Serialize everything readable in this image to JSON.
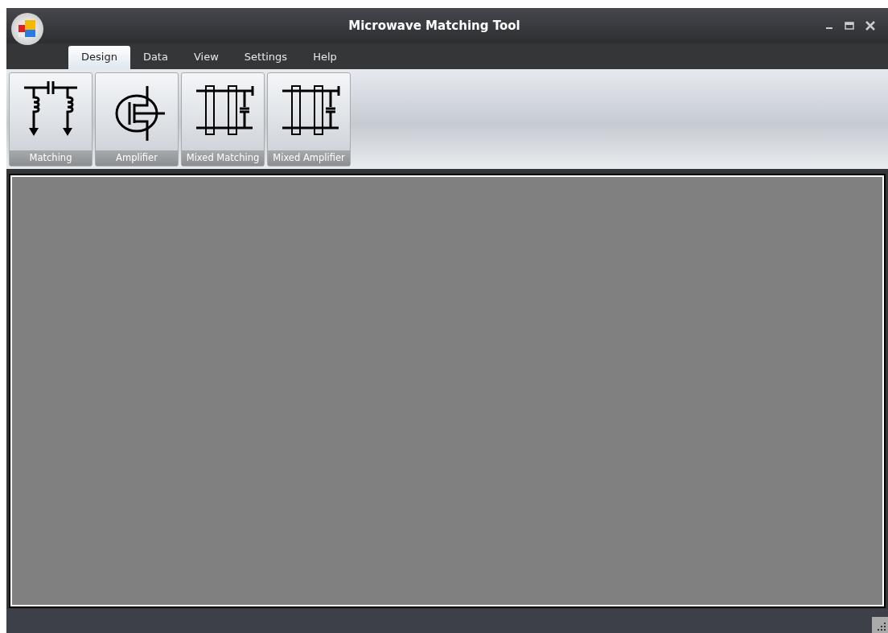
{
  "window": {
    "title": "Microwave Matching Tool"
  },
  "tabs": [
    {
      "label": "Design",
      "selected": true
    },
    {
      "label": "Data",
      "selected": false
    },
    {
      "label": "View",
      "selected": false
    },
    {
      "label": "Settings",
      "selected": false
    },
    {
      "label": "Help",
      "selected": false
    }
  ],
  "ribbon": {
    "buttons": [
      {
        "label": "Matching",
        "kind": "matching"
      },
      {
        "label": "Amplifier",
        "kind": "amplifier"
      },
      {
        "label": "Mixed Matching",
        "kind": "mixed"
      },
      {
        "label": "Mixed Amplifier",
        "kind": "mixed"
      }
    ]
  }
}
